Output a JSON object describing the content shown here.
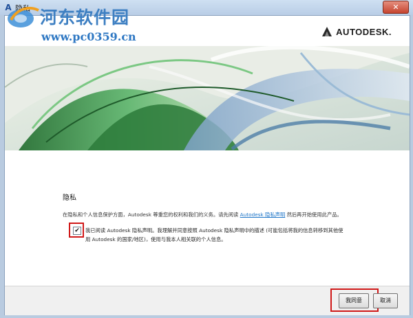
{
  "window": {
    "title": "隐私",
    "close_label": "✕"
  },
  "watermark": {
    "site_name": "河东软件园",
    "url": "www.pc0359.cn"
  },
  "brand": {
    "name": "AUTODESK."
  },
  "privacy": {
    "heading": "隐私",
    "intro_before": "在隐私和个人信息保护方面，Autodesk 尊重您的权利和我们的义务。请先阅读 ",
    "intro_link": "Autodesk 隐私声明",
    "intro_after": " 然后再开始使用此产品。",
    "checkbox_checked": true,
    "checkbox_mark": "✔",
    "agree_line1": "我已阅读 Autodesk 隐私声明。我理解并同意按照 Autodesk 隐私声明中的描述 (可能包括将我的信息转移到其他使",
    "agree_line2": "用 Autodesk 的国家/地区)，使用与我本人相关联的个人信息。"
  },
  "buttons": {
    "agree": "我同意",
    "cancel": "取消"
  },
  "colors": {
    "highlight": "#d01818",
    "link": "#1a73c7",
    "accent_green": "#3f9a4f"
  }
}
